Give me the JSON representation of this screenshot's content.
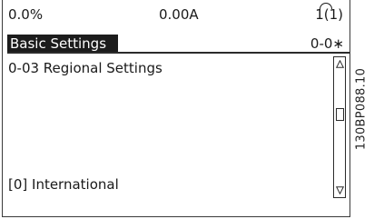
{
  "status": {
    "reference": "0.0%",
    "current": "0.00A",
    "setup_active": "1",
    "setup_edit": "(1)"
  },
  "menu": {
    "title": "Basic Settings",
    "parameter_group": "0-0∗"
  },
  "parameter": {
    "title": "0-03 Regional Settings",
    "value": "[0] International"
  },
  "figure_code": "130BP088.10",
  "icons": {
    "scroll_up": "triangle-up-icon",
    "scroll_down": "triangle-down-icon"
  }
}
